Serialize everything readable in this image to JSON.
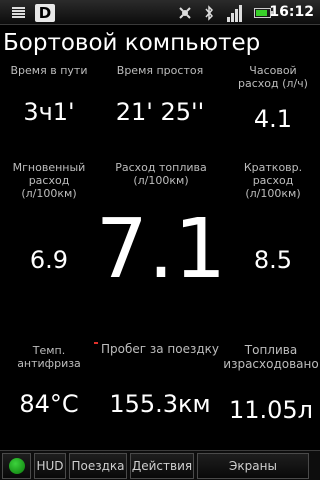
{
  "status_bar": {
    "app_icon_letter": "D",
    "time": "16:12",
    "battery_level": 0.85,
    "signal_level": 4,
    "icons": [
      "menu-icon",
      "app-icon",
      "gps-icon",
      "bluetooth-icon",
      "signal-icon",
      "battery-icon"
    ]
  },
  "title": "Бортовой компьютер",
  "metrics": {
    "travel_time": {
      "label": "Время в пути",
      "value": "3ч1'"
    },
    "idle_time": {
      "label": "Время простоя",
      "value": "21' 25''"
    },
    "hourly_consumption": {
      "label": "Часовой расход (л/ч)",
      "value": "4.1"
    },
    "instant_consumption": {
      "label": "Мгновенный расход (л/100км)",
      "value": "6.9"
    },
    "fuel_consumption": {
      "label": "Расход топлива (л/100км)",
      "value": "7.1"
    },
    "short_consumption": {
      "label": "Кратковр. расход (л/100км)",
      "value": "8.5"
    },
    "antifreeze_temp": {
      "label": "Темп. антифриза",
      "value": "84°C"
    },
    "trip_distance": {
      "label": "Пробег за поездку",
      "value": "155.3км"
    },
    "fuel_used": {
      "label": "Топлива израсходовано",
      "value": "11.05л"
    }
  },
  "tabs": [
    {
      "label": "HUD"
    },
    {
      "label": "Поездка"
    },
    {
      "label": "Действия"
    },
    {
      "label": "Экраны"
    }
  ],
  "colors": {
    "background": "#000000",
    "label": "#bdbdbd",
    "value": "#ffffff",
    "indicator": "#2fbf2f",
    "battery": "#39d02a"
  }
}
